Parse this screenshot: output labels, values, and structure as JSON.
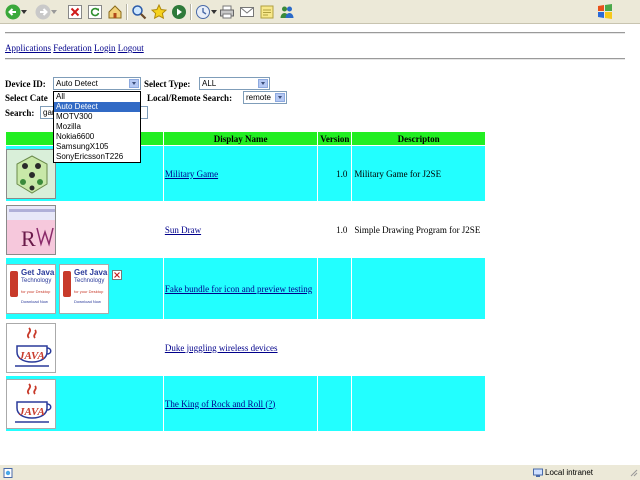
{
  "toolbar": {
    "icons": [
      "back-icon",
      "forward-icon",
      "stop-icon",
      "refresh-icon",
      "home-icon",
      "search-icon",
      "favorites-icon",
      "media-icon",
      "history-icon",
      "mail-icon",
      "print-icon",
      "edit-icon",
      "discuss-icon",
      "messenger-icon"
    ]
  },
  "nav": {
    "applications": "Applications",
    "federation": "Federation",
    "login": "Login",
    "logout": "Logout"
  },
  "form": {
    "device_id_label": "Device ID:",
    "device_id_value": "Auto Detect",
    "select_type_label": "Select Type:",
    "select_type_value": "ALL",
    "select_category_label": "Select Cate",
    "local_remote_label": "Local/Remote Search:",
    "local_remote_value": "remote",
    "search_label": "Search:",
    "search_value": "gar",
    "device_options": [
      "All",
      "Auto Detect",
      "MOTV300",
      "Mozilla",
      "Nokia6600",
      "SamsungX105",
      "SonyEricssonT226"
    ],
    "device_selected_index": 1
  },
  "table": {
    "headers": [
      "",
      "Display Name",
      "Version",
      "Descripton"
    ],
    "rows": [
      {
        "name": "Military Game",
        "version": "1.0",
        "description": "Military Game for J2SE"
      },
      {
        "name": "Sun Draw",
        "version": "1.0",
        "description": "Simple Drawing Program for J2SE"
      },
      {
        "name": "Fake bundle for icon and preview testing",
        "version": "",
        "description": ""
      },
      {
        "name": "Duke juggling wireless devices",
        "version": "",
        "description": ""
      },
      {
        "name": "The King of Rock and Roll (?)",
        "version": "",
        "description": ""
      }
    ],
    "get_java": {
      "line1": "Get Java",
      "line2": "Technology",
      "line3": "for your Desktop",
      "line4": "Download Now"
    },
    "java_logo_text": "JAVA"
  },
  "status": {
    "zone": "Local intranet"
  },
  "colors": {
    "header_green": "#22ee22",
    "row_cyan": "#22ffff",
    "link": "#00008b"
  }
}
